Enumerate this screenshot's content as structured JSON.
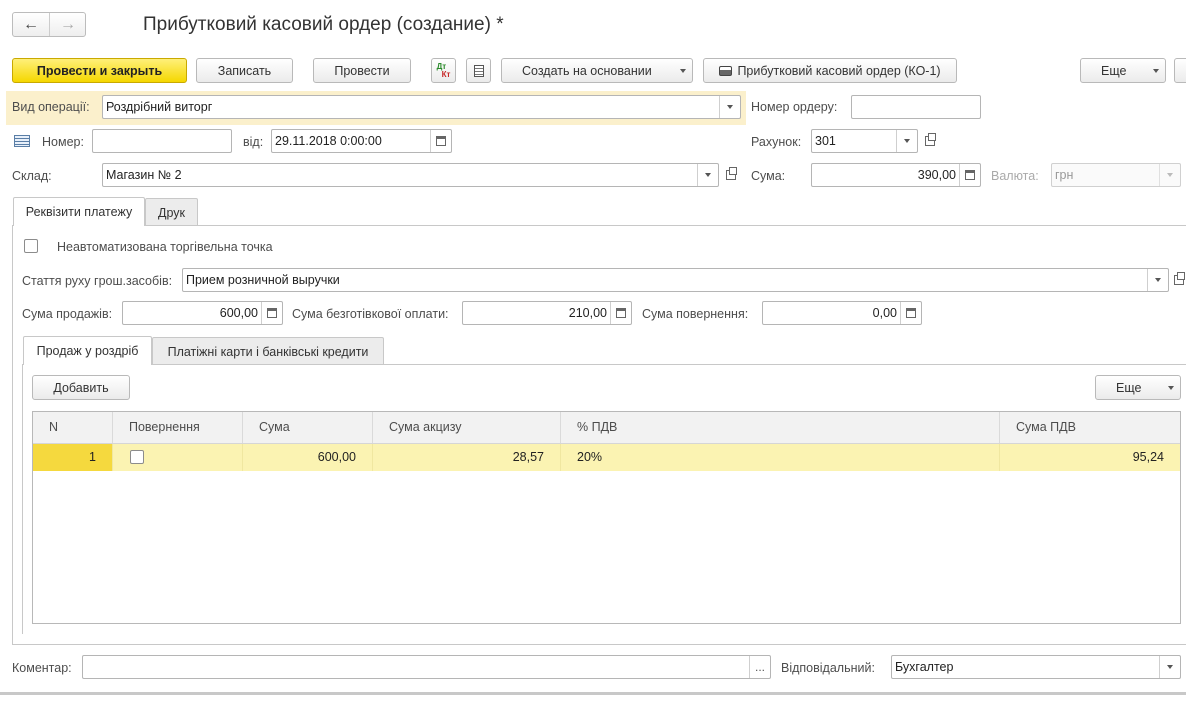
{
  "window": {
    "title": "Прибутковий касовий ордер (создание) *"
  },
  "nav": {
    "back_icon": "←",
    "forward_icon": "→"
  },
  "toolbar": {
    "post_close": "Провести и закрыть",
    "save": "Записать",
    "post": "Провести",
    "dtkt_icon_top": "Дт",
    "dtkt_icon_bottom": "Кт",
    "create_based": "Создать на основании",
    "print_ko1": "Прибутковий касовий ордер (КО-1)",
    "more": "Еще"
  },
  "header": {
    "operation_type_label": "Вид операції:",
    "operation_type_value": "Роздрібний виторг",
    "order_number_label": "Номер ордеру:",
    "order_number_value": "",
    "number_label": "Номер:",
    "number_value": "",
    "date_label": "від:",
    "date_value": "29.11.2018  0:00:00",
    "account_label": "Рахунок:",
    "account_value": "301",
    "warehouse_label": "Склад:",
    "warehouse_value": "Магазин № 2",
    "sum_label": "Сума:",
    "sum_value": "390,00",
    "currency_label": "Валюта:",
    "currency_value": "грн"
  },
  "tabs": [
    {
      "label": "Реквізити платежу",
      "active": true
    },
    {
      "label": "Друк",
      "active": false
    }
  ],
  "payment": {
    "nonauto_label": "Неавтоматизована торгівельна точка",
    "nonauto_checked": false,
    "cashflow_label": "Стаття руху грош.засобів:",
    "cashflow_value": "Прием розничной выручки",
    "sales_sum_label": "Сума продажів:",
    "sales_sum_value": "600,00",
    "noncash_label": "Сума безготівкової оплати:",
    "noncash_value": "210,00",
    "return_label": "Сума повернення:",
    "return_value": "0,00"
  },
  "subtabs": [
    {
      "label": "Продаж у роздріб",
      "active": true
    },
    {
      "label": "Платіжні карти і банківські кредити",
      "active": false
    }
  ],
  "table": {
    "add_button": "Добавить",
    "more_button": "Еще",
    "columns": [
      "N",
      "Повернення",
      "Сума",
      "Сума акцизу",
      "% ПДВ",
      "Сума ПДВ"
    ],
    "rows": [
      {
        "n": "1",
        "returned": false,
        "sum": "600,00",
        "excise": "28,57",
        "vat_rate": "20%",
        "vat_sum": "95,24"
      }
    ]
  },
  "footer": {
    "comment_label": "Коментар:",
    "comment_value": "",
    "comment_button": "...",
    "responsible_label": "Відповідальний:",
    "responsible_value": "Бухгалтер"
  },
  "colors": {
    "primary_button": "#f5d700",
    "highlight_row": "#fbf3b2",
    "operation_row_bg": "#fbf0cc"
  }
}
